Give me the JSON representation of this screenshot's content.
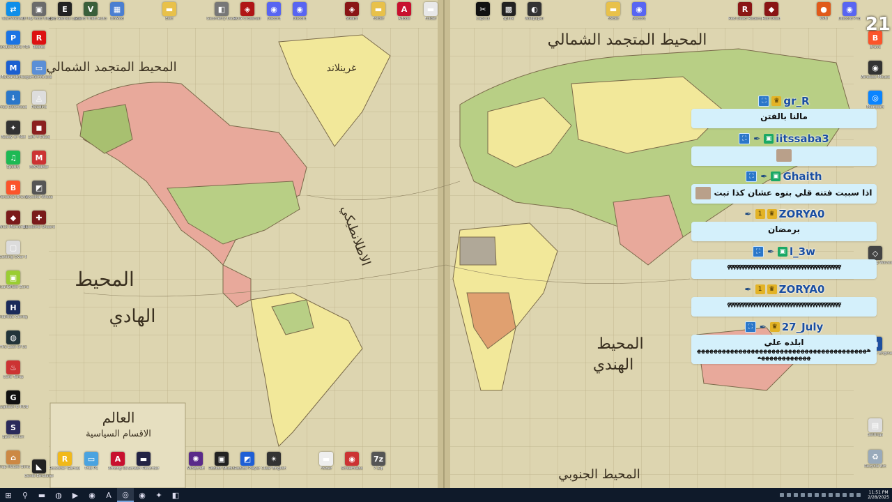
{
  "desktop": {
    "top_row": [
      {
        "label": "TeamViewer",
        "icon": "teamviewer-icon",
        "color": "#0e8ee9",
        "glyph": "⇄"
      },
      {
        "label": "Di My Mod Ultra Speed",
        "icon": "app-icon",
        "color": "#6b6b6b",
        "glyph": "▣"
      },
      {
        "label": "Epic Games Launcher",
        "icon": "epic-games-icon",
        "color": "#222",
        "glyph": "E"
      },
      {
        "label": "Grand Theft Auto V",
        "icon": "gta-icon",
        "color": "#3a5f3a",
        "glyph": "V"
      },
      {
        "label": "DnMod",
        "icon": "app-icon",
        "color": "#4b7fd1",
        "glyph": "▦"
      },
      {
        "label": "Ewn",
        "icon": "folder-icon",
        "color": "#e8c14a",
        "glyph": "▬"
      },
      {
        "label": "Geometry Dash",
        "icon": "app-icon",
        "color": "#777",
        "glyph": "◧"
      },
      {
        "label": "ROG Crosshair",
        "icon": "app-icon",
        "color": "#b01515",
        "glyph": "◈"
      },
      {
        "label": "Discord",
        "icon": "discord-icon",
        "color": "#5865f2",
        "glyph": "◉"
      },
      {
        "label": "Discord",
        "icon": "discord-icon",
        "color": "#5865f2",
        "glyph": "◉"
      },
      {
        "label": "Steam",
        "icon": "app-icon",
        "color": "#8a1515",
        "glyph": "◈"
      },
      {
        "label": "Folder",
        "icon": "folder-icon",
        "color": "#e8c14a",
        "glyph": "▬"
      },
      {
        "label": "Adobe",
        "icon": "adobe-icon",
        "color": "#c8102e",
        "glyph": "A"
      },
      {
        "label": "Folder",
        "icon": "folder-icon",
        "color": "#e8e8e8",
        "glyph": "▬"
      },
      {
        "label": "CapCut",
        "icon": "capcut-icon",
        "color": "#111",
        "glyph": "✂"
      },
      {
        "label": "Spline",
        "icon": "app-icon",
        "color": "#222",
        "glyph": "▩"
      },
      {
        "label": "Wallpaper",
        "icon": "app-icon",
        "color": "#333",
        "glyph": "◐"
      },
      {
        "label": "Folder",
        "icon": "folder-icon",
        "color": "#e8c14a",
        "glyph": "▬"
      },
      {
        "label": "Discord",
        "icon": "discord-icon",
        "color": "#5865f2",
        "glyph": "◉"
      },
      {
        "label": "Red Dead Redemption",
        "icon": "app-icon",
        "color": "#8a1515",
        "glyph": "R"
      },
      {
        "label": "Red Dead",
        "icon": "app-icon",
        "color": "#8a1515",
        "glyph": "◆"
      },
      {
        "label": "VPN",
        "icon": "app-icon",
        "color": "#e05a1a",
        "glyph": "●"
      },
      {
        "label": "Discord PTB",
        "icon": "discord-icon",
        "color": "#5865f2",
        "glyph": "◉"
      }
    ],
    "left_column": [
      {
        "label": "Wondershare PDFelement",
        "icon": "app-icon",
        "color": "#1b74e4",
        "glyph": "P"
      },
      {
        "label": "Malwarebytes",
        "icon": "app-icon",
        "color": "#1b5fd1",
        "glyph": "M"
      },
      {
        "label": "Free Download",
        "icon": "app-icon",
        "color": "#2b77c9",
        "glyph": "↓"
      },
      {
        "label": "Ready or Not",
        "icon": "app-icon",
        "color": "#333",
        "glyph": "✦"
      },
      {
        "label": "Spotify",
        "icon": "spotify-icon",
        "color": "#1db954",
        "glyph": "♫"
      },
      {
        "label": "Personal Brave",
        "icon": "brave-icon",
        "color": "#fb542b",
        "glyph": "B"
      },
      {
        "label": "Wick Memories",
        "icon": "app-icon",
        "color": "#7a1a1a",
        "glyph": "◆"
      },
      {
        "label": "Getting Over It",
        "icon": "app-icon",
        "color": "#dcdcdc",
        "glyph": "▢"
      },
      {
        "label": "QuartzRow Zone",
        "icon": "app-icon",
        "color": "#9acd32",
        "glyph": "▣"
      },
      {
        "label": "HidHide Config",
        "icon": "app-icon",
        "color": "#1a2a5a",
        "glyph": "H"
      },
      {
        "label": "The Last of Us",
        "icon": "app-icon",
        "color": "#22343a",
        "glyph": "◍"
      },
      {
        "label": "Core Temp",
        "icon": "app-icon",
        "color": "#c33",
        "glyph": "♨"
      },
      {
        "label": "Logitech G HUB",
        "icon": "app-icon",
        "color": "#111",
        "glyph": "G"
      },
      {
        "label": "Split Fiction",
        "icon": "app-icon",
        "color": "#2a2a5a",
        "glyph": "S"
      },
      {
        "label": "Wrap House Simulator",
        "icon": "app-icon",
        "color": "#c84",
        "glyph": "⌂"
      }
    ],
    "second_column": [
      {
        "label": "Roblox",
        "icon": "app-icon",
        "color": "#d11",
        "glyph": "R"
      },
      {
        "label": "gameinfo.exe",
        "icon": "app-icon",
        "color": "#5b8fd6",
        "glyph": "▭"
      },
      {
        "label": "Paladins",
        "icon": "app-icon",
        "color": "#ddd",
        "glyph": "◬"
      },
      {
        "label": "Left 4 Dead",
        "icon": "app-icon",
        "color": "#8b2020",
        "glyph": "◼"
      },
      {
        "label": "MAPeditor",
        "icon": "app-icon",
        "color": "#c33",
        "glyph": "M"
      },
      {
        "label": "Wysoka Wieza",
        "icon": "app-icon",
        "color": "#555",
        "glyph": "◩"
      },
      {
        "label": "Bloodline Unsent",
        "icon": "app-icon",
        "color": "#7a1a1a",
        "glyph": "✚"
      },
      {
        "label": "Genie Emulator",
        "icon": "app-icon",
        "color": "#222",
        "glyph": "◣"
      }
    ],
    "right_column": [
      {
        "label": "Brave",
        "icon": "brave-icon",
        "color": "#fb542b",
        "glyph": "B"
      },
      {
        "label": "Wireless Mouse",
        "icon": "app-icon",
        "color": "#333",
        "glyph": "◉"
      },
      {
        "label": "Microsoft",
        "icon": "app-icon",
        "color": "#0a84ff",
        "glyph": "◎"
      },
      {
        "label": "Wuthering Waves",
        "icon": "app-icon",
        "color": "#444",
        "glyph": "◇"
      },
      {
        "label": "Wallpaper Engine",
        "icon": "app-icon",
        "color": "#1e4fa0",
        "glyph": "◼"
      },
      {
        "label": "Settings",
        "icon": "app-icon",
        "color": "#ddd",
        "glyph": "▤"
      },
      {
        "label": "Recycle Bin",
        "icon": "recycle-bin-icon",
        "color": "#9ab",
        "glyph": "♻"
      }
    ],
    "bottom_row": [
      {
        "label": "Rockstar Games",
        "icon": "rockstar-icon",
        "color": "#f1b91a",
        "glyph": "R"
      },
      {
        "label": "This PC",
        "icon": "this-pc-icon",
        "color": "#4aa3e0",
        "glyph": "▭"
      },
      {
        "label": "Among Us",
        "icon": "adobe-icon",
        "color": "#c8102e",
        "glyph": "A"
      },
      {
        "label": "Screen Recorder",
        "icon": "app-icon",
        "color": "#224",
        "glyph": "▬"
      },
      {
        "label": "Minecraft",
        "icon": "app-icon",
        "color": "#5a2a8a",
        "glyph": "✺"
      },
      {
        "label": "Roblox Studio",
        "icon": "app-icon",
        "color": "#222",
        "glyph": "▣"
      },
      {
        "label": "Roblox Player",
        "icon": "app-icon",
        "color": "#1e5fd6",
        "glyph": "◩"
      },
      {
        "label": "Clear English",
        "icon": "app-icon",
        "color": "#333",
        "glyph": "✴"
      },
      {
        "label": "Folder",
        "icon": "folder-icon",
        "color": "#eee",
        "glyph": "▬"
      },
      {
        "label": "Streamlabs",
        "icon": "app-icon",
        "color": "#c33",
        "glyph": "◉"
      },
      {
        "label": "7-Zip",
        "icon": "zip-icon",
        "color": "#555",
        "glyph": "7z"
      }
    ]
  },
  "overlay": {
    "corner_number": "21"
  },
  "chat": {
    "messages": [
      {
        "user": "gr_R",
        "badges": [
          "blue",
          "gold"
        ],
        "text": "مالنا بالفتن",
        "rtl": true,
        "wave": false,
        "emote": false
      },
      {
        "user": "iitssaba3",
        "badges": [
          "blue",
          "feather",
          "green"
        ],
        "text": "",
        "rtl": true,
        "wave": false,
        "emote": true
      },
      {
        "user": "Ghaith",
        "badges": [
          "blue",
          "feather",
          "green"
        ],
        "text": "اذا سببت فتنه قلي بنوه عشان كذا تبت",
        "rtl": true,
        "wave": false,
        "emote": true
      },
      {
        "user": "ZORYA0",
        "badges": [
          "feather",
          "gold-1",
          "gold"
        ],
        "text": "برمضان",
        "rtl": true,
        "wave": false,
        "emote": false
      },
      {
        "user": "l_3w",
        "badges": [
          "blue",
          "feather",
          "green"
        ],
        "text": "𝓆𝓆𝓆𝓆𝓆𝓆𝓆𝓆𝓆𝓆𝓆𝓆𝓆𝓆𝓆𝓆𝓆𝓆𝓆𝓆𝓆𝓆𝓆𝓆𝓆𝓆𝓆𝓆𝓆𝓆𝓆𝓆𝓆𝓆𝓆𝓆𝓆𝓆𝓆𝓆",
        "rtl": false,
        "wave": true,
        "emote": false
      },
      {
        "user": "ZORYA0",
        "badges": [
          "feather",
          "gold-1",
          "gold"
        ],
        "text": "𝓆𝓆𝓆𝓆𝓆𝓆𝓆𝓆𝓆𝓆𝓆𝓆𝓆𝓆𝓆𝓆𝓆𝓆𝓆𝓆𝓆𝓆𝓆𝓆𝓆𝓆𝓆𝓆𝓆𝓆𝓆𝓆𝓆𝓆𝓆𝓆𝓆𝓆𝓆𝓆",
        "rtl": false,
        "wave": true,
        "emote": false
      },
      {
        "user": "27_July",
        "badges": [
          "blue",
          "feather",
          "gold"
        ],
        "text": "ابلده علي",
        "text2": "ههههههههههههههههههههههههههههههههههههههههههههههههههههههه",
        "rtl": true,
        "wave": false,
        "emote": false
      }
    ]
  },
  "map": {
    "labels": {
      "arctic_left": "المحيط المتجمد الشمالي",
      "arctic_right": "المحيط المتجمد الشمالي",
      "pacific_left_1": "المحيط",
      "pacific_left_2": "الهادي",
      "atlantic": "الاطلانطيكي",
      "indian_1": "المحيط",
      "indian_2": "الهندي",
      "southern": "المحيط الجنوبي",
      "greenland": "غرينلاند",
      "title_1": "العالم",
      "title_2": "الاقسام السياسية"
    }
  },
  "taskbar": {
    "items": [
      {
        "icon": "windows-start-icon",
        "glyph": "⊞",
        "active": false
      },
      {
        "icon": "search-icon",
        "glyph": "⚲",
        "active": false
      },
      {
        "icon": "file-explorer-icon",
        "glyph": "▬",
        "active": false
      },
      {
        "icon": "steam-icon",
        "glyph": "◍",
        "active": false
      },
      {
        "icon": "youtube-icon",
        "glyph": "▶",
        "active": false
      },
      {
        "icon": "discord-icon",
        "glyph": "◉",
        "active": false
      },
      {
        "icon": "adobe-icon",
        "glyph": "A",
        "active": false
      },
      {
        "icon": "obs-icon",
        "glyph": "◎",
        "active": true
      },
      {
        "icon": "chrome-icon",
        "glyph": "◉",
        "active": false
      },
      {
        "icon": "app-icon",
        "glyph": "✦",
        "active": false
      },
      {
        "icon": "app-icon",
        "glyph": "◧",
        "active": false
      }
    ],
    "clock_time": "11:51 PM",
    "clock_date": "2/28/2025"
  }
}
